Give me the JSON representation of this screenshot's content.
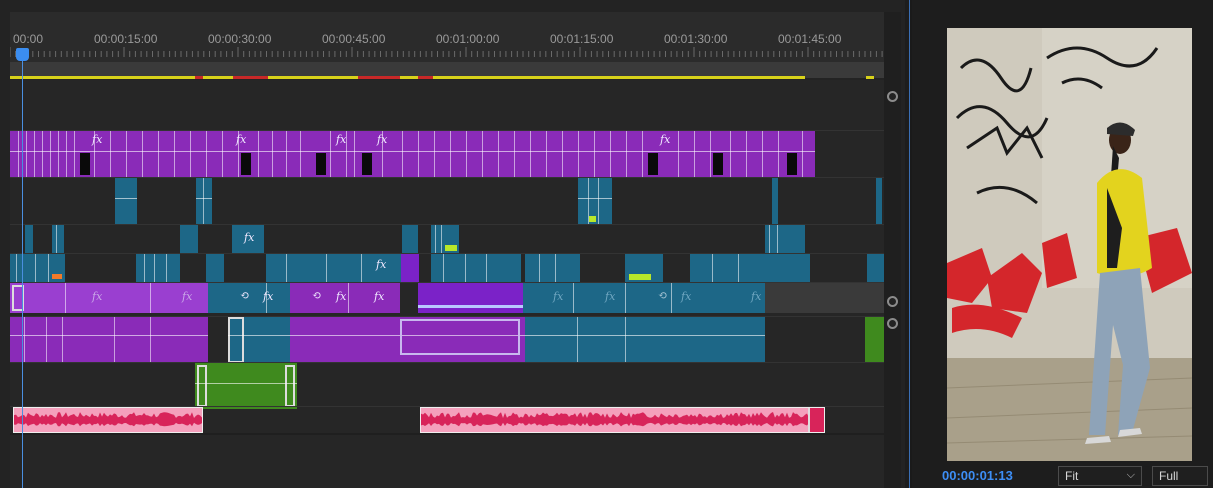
{
  "ruler": {
    "timecodes": [
      "00:00",
      "00:00:15:00",
      "00:00:30:00",
      "00:00:45:00",
      "00:01:00:00",
      "00:01:15:00",
      "00:01:30:00",
      "00:01:45:00"
    ]
  },
  "clips": {
    "fx_label": "fx"
  },
  "monitor": {
    "timecode": "00:00:01:13",
    "fit_label": "Fit",
    "quality_label": "Full"
  },
  "colors": {
    "purple": "#8a2bb8",
    "teal": "#1d6787",
    "green": "#3f8a1e",
    "audio_pink": "#f4a0bc",
    "audio_red": "#d8245a",
    "playhead": "#3b8df0"
  },
  "icons": {
    "playhead": "playhead-icon",
    "dropdown": "chevron-down-icon",
    "track_knob": "track-height-knob-icon"
  }
}
